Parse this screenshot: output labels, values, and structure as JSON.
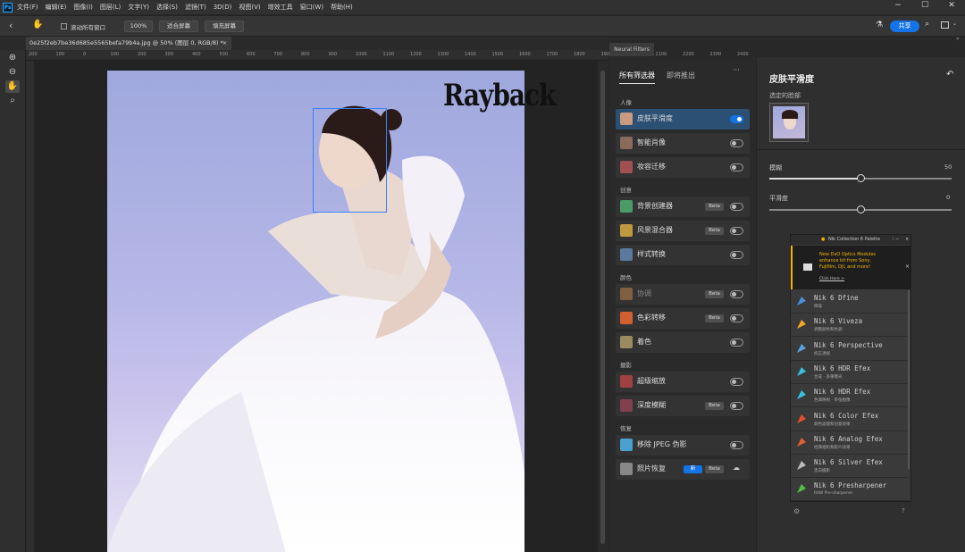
{
  "menubar": {
    "items": [
      "文件(F)",
      "编辑(E)",
      "图像(I)",
      "图层(L)",
      "文字(Y)",
      "选择(S)",
      "滤镜(T)",
      "3D(D)",
      "视图(V)",
      "增效工具",
      "窗口(W)",
      "帮助(H)"
    ]
  },
  "options": {
    "scroll_all": "滚动所有窗口",
    "zoom": "100%",
    "fit_screen": "适合屏幕",
    "fill_screen": "填充屏幕",
    "share": "共享"
  },
  "document": {
    "tab_title": "0e25f2eb7be36d685e5565befa79b4a.jpg @ 50% (图层 0, RGB/8) *"
  },
  "ruler": {
    "ticks": [
      "200",
      "100",
      "0",
      "100",
      "200",
      "300",
      "400",
      "500",
      "600",
      "700",
      "800",
      "900",
      "1000",
      "1100",
      "1200",
      "1300",
      "1400",
      "1500",
      "1600",
      "1700",
      "1800",
      "1900",
      "2000",
      "2100",
      "2200",
      "2300",
      "2400"
    ]
  },
  "image": {
    "brand_text": "Rayback"
  },
  "neural_filters": {
    "panel_tab": "Neural Filters",
    "tab_all": "所有筛选器",
    "tab_soon": "即将推出",
    "more": "···",
    "sections": [
      {
        "title": "人像",
        "items": [
          {
            "label": "皮肤平滑度",
            "on": true,
            "beta": false,
            "selected": true,
            "thumb": "#c89a80"
          },
          {
            "label": "智能肖像",
            "on": false,
            "beta": false,
            "selected": false,
            "thumb": "#8a6a5a"
          },
          {
            "label": "妆容迁移",
            "on": false,
            "beta": false,
            "selected": false,
            "thumb": "#a05050"
          }
        ]
      },
      {
        "title": "创意",
        "items": [
          {
            "label": "背景创建器",
            "on": false,
            "beta": true,
            "selected": false,
            "thumb": "#4a9a6a"
          },
          {
            "label": "风景混合器",
            "on": false,
            "beta": true,
            "selected": false,
            "thumb": "#c09a40"
          },
          {
            "label": "样式转换",
            "on": false,
            "beta": false,
            "selected": false,
            "thumb": "#5a7aa0"
          }
        ]
      },
      {
        "title": "颜色",
        "items": [
          {
            "label": "协调",
            "on": false,
            "beta": true,
            "selected": false,
            "dim": true,
            "thumb": "#806040"
          },
          {
            "label": "色彩转移",
            "on": false,
            "beta": true,
            "selected": false,
            "thumb": "#d06030"
          },
          {
            "label": "着色",
            "on": false,
            "beta": false,
            "selected": false,
            "thumb": "#9a8a60"
          }
        ]
      },
      {
        "title": "摄影",
        "items": [
          {
            "label": "超级缩放",
            "on": false,
            "beta": false,
            "selected": false,
            "thumb": "#a04040"
          },
          {
            "label": "深度模糊",
            "on": false,
            "beta": true,
            "selected": false,
            "thumb": "#804050"
          }
        ]
      },
      {
        "title": "恢复",
        "items": [
          {
            "label": "移除 JPEG 伪影",
            "on": false,
            "beta": false,
            "selected": false,
            "thumb": "#4aa0d0"
          },
          {
            "label": "照片恢复",
            "on": false,
            "beta": true,
            "new": "新",
            "cloud": true,
            "selected": false,
            "thumb": "#888888"
          }
        ]
      }
    ]
  },
  "detail": {
    "title": "皮肤平滑度",
    "selected_face_label": "选定的脸部",
    "blur_label": "模糊",
    "blur_value": "50",
    "blur_fraction": 0.5,
    "smooth_label": "平滑度",
    "smooth_value": "0",
    "smooth_fraction": 0.5
  },
  "nik": {
    "title": "Nik Collection 6 Palette",
    "promo_text": "New DxO Optics Modules enhance kit from Sony, Fujifilm, DJI, and more!",
    "promo_link": "Click Here >",
    "items": [
      {
        "name": "Nik 6 Dfine",
        "sub": "降噪",
        "color": "#4a90d9"
      },
      {
        "name": "Nik 6 Viveza",
        "sub": "调整颜色和色调",
        "color": "#f5a623"
      },
      {
        "name": "Nik 6 Perspective",
        "sub": "校正透视",
        "color": "#5aa0e0"
      },
      {
        "name": "Nik 6 HDR Efex",
        "sub": "合成 - 多重曝光",
        "color": "#3ac0e0"
      },
      {
        "name": "Nik 6 HDR Efex",
        "sub": "色调映射 - 单张图像",
        "color": "#3ac0e0"
      },
      {
        "name": "Nik 6 Color Efex",
        "sub": "颜色滤镜和创意效果",
        "color": "#e05030"
      },
      {
        "name": "Nik 6 Analog Efex",
        "sub": "经典相机和胶片效果",
        "color": "#e06030"
      },
      {
        "name": "Nik 6 Silver Efex",
        "sub": "黑白摄影",
        "color": "#bbbbbb"
      },
      {
        "name": "Nik 6 Presharpener",
        "sub": "RAW Pre-sharpener",
        "color": "#50c040"
      }
    ]
  }
}
